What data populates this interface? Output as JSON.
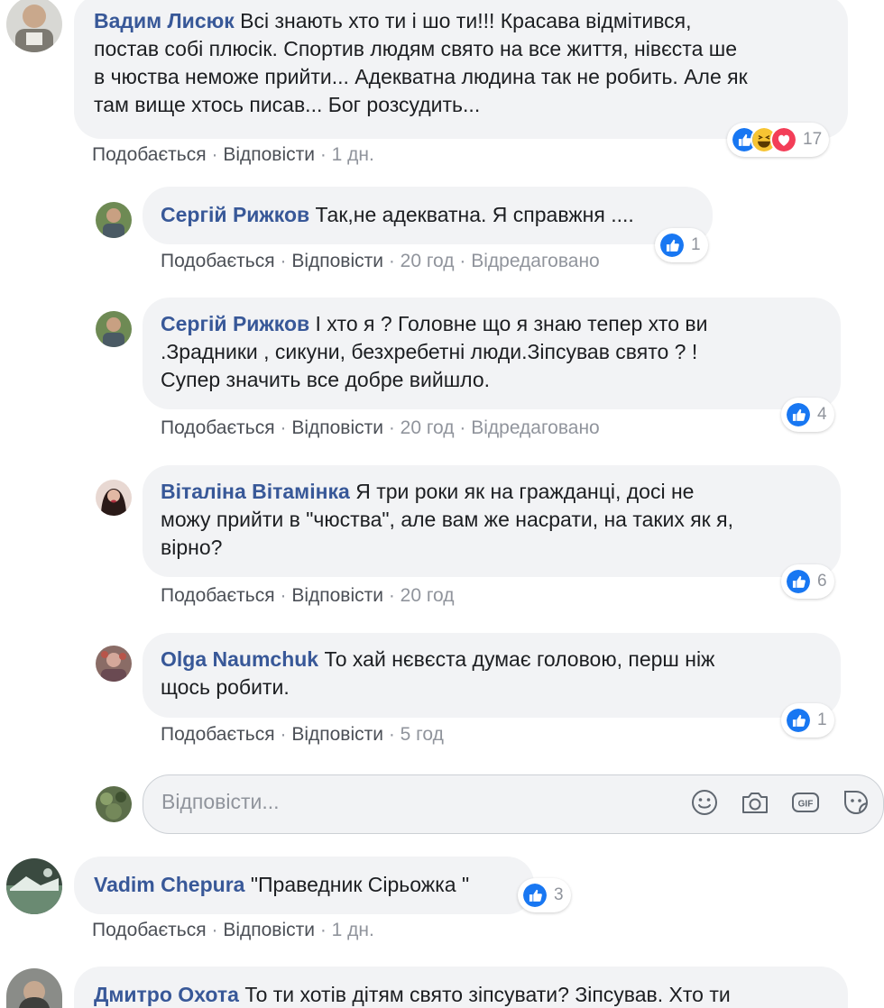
{
  "comments": [
    {
      "author": "Вадим Лисюк",
      "lines": [
        "Всі знають хто ти і шо ти!!! Красава відмітився,",
        "постав собі плюсік. Спортив людям свято на все життя, нівєста ше",
        "в чюства неможе прийти... Адекватна людина так не робить. Але як",
        "там вище хтось писав... Бог розсудить..."
      ],
      "like": "Подобається",
      "reply": "Відповісти",
      "time": "1 дн.",
      "reactions": {
        "count": "17",
        "icons": [
          "like-icon",
          "haha-icon",
          "love-icon"
        ]
      }
    },
    {
      "author": "Сергій Рижков",
      "lines": [
        "Так,не адекватна. Я справжня ...."
      ],
      "like": "Подобається",
      "reply": "Відповісти",
      "time": "20 год",
      "edited": "Відредаговано",
      "reactions": {
        "count": "1",
        "icons": [
          "like-icon"
        ]
      }
    },
    {
      "author": "Сергій Рижков",
      "lines": [
        "І хто я ? Головне що я знаю тепер хто ви",
        ".Зрадники , сикуни, безхребетні люди.Зіпсував свято ? !",
        "Супер значить все добре вийшло."
      ],
      "like": "Подобається",
      "reply": "Відповісти",
      "time": "20 год",
      "edited": "Відредаговано",
      "reactions": {
        "count": "4",
        "icons": [
          "like-icon"
        ]
      }
    },
    {
      "author": "Віталіна Вітамінка",
      "lines": [
        "Я три роки як на гражданці, досі не",
        "можу прийти в \"чюства\", але вам же насрати, на таких як я,",
        "вірно?"
      ],
      "like": "Подобається",
      "reply": "Відповісти",
      "time": "20 год",
      "reactions": {
        "count": "6",
        "icons": [
          "like-icon"
        ]
      }
    },
    {
      "author": "Olga Naumchuk",
      "lines": [
        "То хай нєвєста думає головою, перш ніж",
        "щось робити."
      ],
      "like": "Подобається",
      "reply": "Відповісти",
      "time": "5 год",
      "reactions": {
        "count": "1",
        "icons": [
          "like-icon"
        ]
      }
    },
    {
      "author": "Vadim Chepura",
      "lines": [
        "\"Праведник Сірьожка \""
      ],
      "like": "Подобається",
      "reply": "Відповісти",
      "time": "1 дн.",
      "reactions": {
        "count": "3",
        "icons": [
          "like-icon"
        ]
      }
    },
    {
      "author": "Дмитро Охота",
      "lines": [
        "То ти хотів дітям свято зіпсувати? Зіпсував. Хто ти"
      ]
    }
  ],
  "reply_box": {
    "placeholder": "Відповісти...",
    "tools": [
      "emoji-icon",
      "camera-icon",
      "gif-icon",
      "sticker-icon"
    ]
  },
  "colors": {
    "author": "#385898",
    "bubble": "#f2f3f5",
    "meta": "#90949c",
    "like_blue": "#1877f2"
  }
}
